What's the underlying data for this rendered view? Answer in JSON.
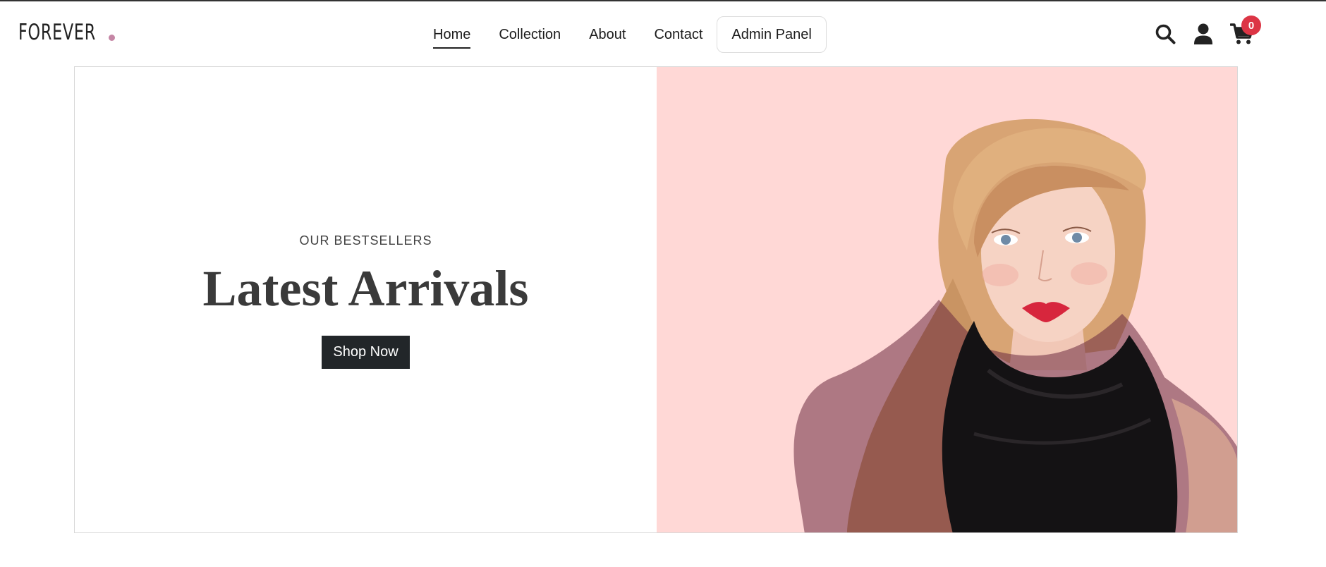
{
  "brand": {
    "name": "FOREVER",
    "dot_color": "#c586a5"
  },
  "nav": {
    "items": [
      {
        "label": "Home",
        "active": true
      },
      {
        "label": "Collection",
        "active": false
      },
      {
        "label": "About",
        "active": false
      },
      {
        "label": "Contact",
        "active": false
      }
    ],
    "admin_label": "Admin Panel"
  },
  "header_icons": {
    "search": "search-icon",
    "profile": "user-icon",
    "cart": "cart-icon",
    "cart_count": "0",
    "badge_color": "#dc3545"
  },
  "hero": {
    "eyebrow": "OUR BESTSELLERS",
    "title": "Latest Arrivals",
    "button_label": "Shop Now",
    "image_bg_color": "#ffd8d6",
    "image_subject": "fashion model in black scarf"
  }
}
